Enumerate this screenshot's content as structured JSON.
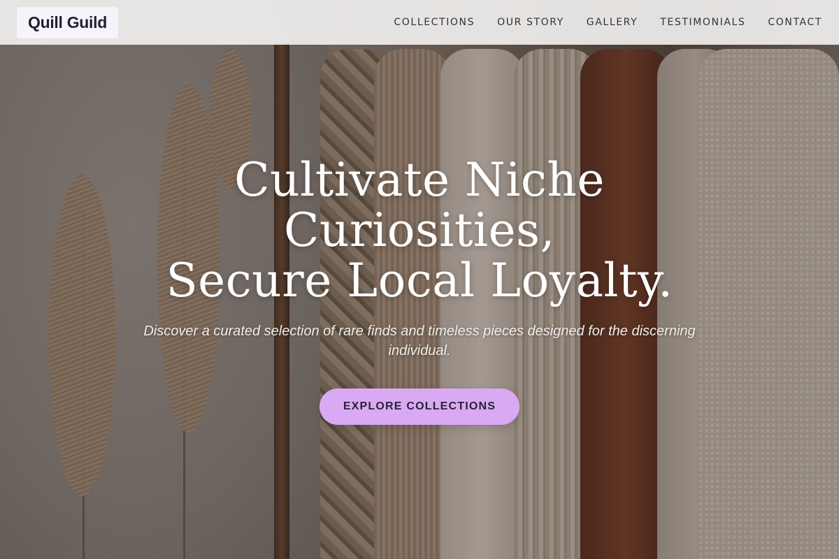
{
  "brand": {
    "name": "Quill Guild"
  },
  "nav": {
    "items": [
      {
        "label": "COLLECTIONS"
      },
      {
        "label": "OUR STORY"
      },
      {
        "label": "GALLERY"
      },
      {
        "label": "TESTIMONIALS"
      },
      {
        "label": "CONTACT"
      }
    ]
  },
  "hero": {
    "headline_lines": [
      "Cultivate Niche",
      "Curiosities,",
      "Secure Local Loyalty."
    ],
    "tagline": "Discover a curated selection of rare finds and timeless pieces designed for the discerning individual.",
    "cta_label": "EXPLORE COLLECTIONS"
  },
  "colors": {
    "accent": "#d9aaf3",
    "nav_background": "#f4f3f2",
    "text_dark": "#1f2230"
  }
}
